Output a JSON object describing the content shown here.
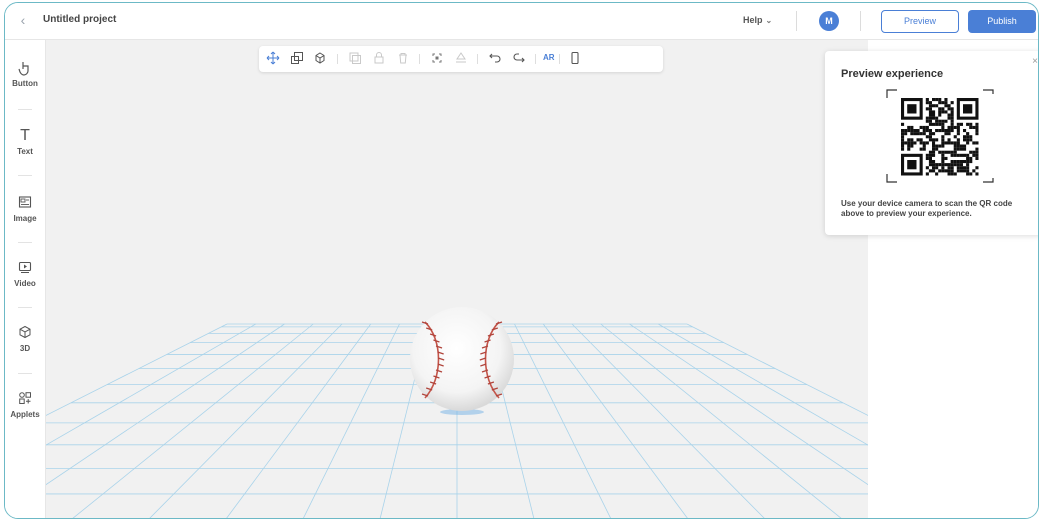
{
  "header": {
    "back_icon": "chevron-left-icon",
    "project_title": "Untitled project",
    "help_label": "Help",
    "avatar_initial": "M",
    "preview_label": "Preview",
    "publish_label": "Publish",
    "accent_color": "#4a7fd6"
  },
  "sidebar": {
    "items": [
      {
        "label": "Button",
        "icon": "hand-pointer-icon"
      },
      {
        "label": "Text",
        "icon": "text-t-icon"
      },
      {
        "label": "Image",
        "icon": "image-icon"
      },
      {
        "label": "Video",
        "icon": "video-icon"
      },
      {
        "label": "3D",
        "icon": "cube-icon"
      },
      {
        "label": "Applets",
        "icon": "applets-icon"
      }
    ]
  },
  "toolbar": {
    "ar_label": "AR",
    "icons": [
      "move-icon",
      "scale-icon",
      "rotate-icon",
      "duplicate-icon",
      "lock-icon",
      "delete-icon",
      "center-icon",
      "ground-icon",
      "undo-icon",
      "redo-icon",
      "mobile-preview-icon"
    ]
  },
  "preview_card": {
    "title": "Preview experience",
    "close_icon": "close-icon",
    "description": "Use your device camera to scan the QR code above to preview your experience."
  },
  "scene": {
    "object": "baseball-model",
    "grid_color": "#a9d3ea"
  }
}
